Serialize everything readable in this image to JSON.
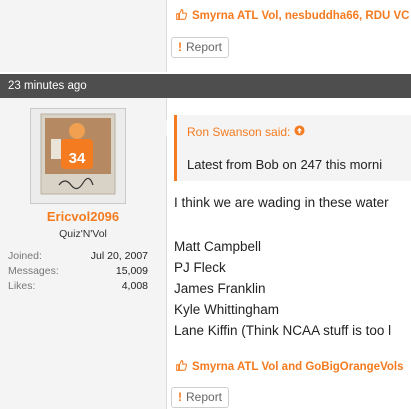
{
  "prev_post": {
    "likes_text": "Smyrna ATL Vol, nesbuddha66, RDU VC",
    "report_label": "Report"
  },
  "post": {
    "timestamp": "23 minutes ago",
    "user": {
      "username": "Ericvol2096",
      "title": "Quiz'N'Vol",
      "stats": [
        {
          "label": "Joined:",
          "value": "Jul 20, 2007"
        },
        {
          "label": "Messages:",
          "value": "15,009"
        },
        {
          "label": "Likes:",
          "value": "4,008"
        }
      ]
    },
    "quote": {
      "author": "Ron Swanson said:",
      "text": "Latest from Bob on 247 this morni"
    },
    "body_lines": [
      "I think we are wading in these water",
      "",
      "Matt Campbell",
      "PJ Fleck",
      "James Franklin",
      "Kyle Whittingham",
      "Lane Kiffin (Think NCAA stuff is too l"
    ],
    "likes_text": "Smyrna ATL Vol and GoBigOrangeVols",
    "report_label": "Report"
  },
  "colors": {
    "accent": "#f47b20",
    "date_bar": "#4e4e4e",
    "sidebar_bg": "#f4f4f4"
  }
}
